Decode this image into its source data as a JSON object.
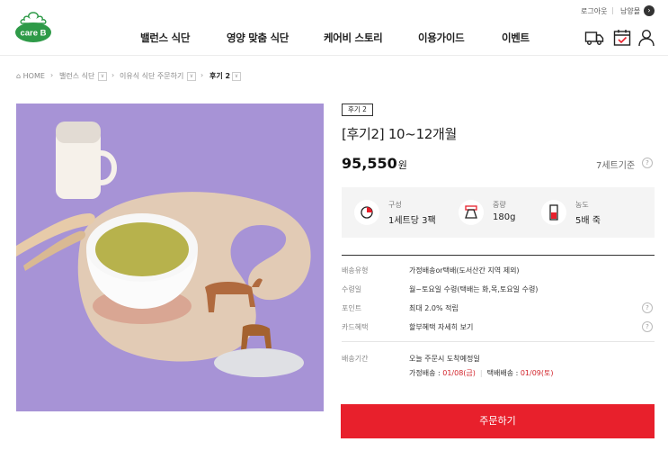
{
  "header": {
    "login_label": "로그아웃",
    "store_label": "남양몰",
    "logo_text": "care B",
    "nav": [
      "밸런스 식단",
      "영양 맞춤 식단",
      "케어비 스토리",
      "이용가이드",
      "이벤트"
    ],
    "icons": [
      "truck-icon",
      "calendar-check-icon",
      "user-icon"
    ]
  },
  "breadcrumb": {
    "home": "HOME",
    "items": [
      "밸런스 식단",
      "이유식 식단 주문하기",
      "후기 2"
    ]
  },
  "product": {
    "tag": "후기 2",
    "title": "[후기2] 10~12개월",
    "price": "95,550",
    "currency": "원",
    "set_basis": "7세트기준",
    "specs": [
      {
        "label": "구성",
        "value": "1세트당 3팩"
      },
      {
        "label": "중량",
        "value": "180g"
      },
      {
        "label": "농도",
        "value": "5배 죽"
      }
    ],
    "info_rows": [
      {
        "label": "배송유형",
        "value": "가정배송or택배(도서산간 지역 제외)"
      },
      {
        "label": "수령일",
        "value": "월~토요일 수령(택배는 화,목,토요일 수령)"
      },
      {
        "label": "포인트",
        "value": "최대 2.0% 적립"
      },
      {
        "label": "카드혜택",
        "value": "할부혜택 자세히 보기"
      }
    ],
    "delivery": {
      "label": "배송기간",
      "line1": "오늘 주문시 도착예정일",
      "home_label": "가정배송 : ",
      "home_date": "01/08(금)",
      "parcel_label": "택배배송 : ",
      "parcel_date": "01/09(토)"
    },
    "order_button": "주문하기"
  },
  "colors": {
    "accent": "#e8202c",
    "brand_green": "#2e9a48",
    "photo_bg": "#a793d6"
  }
}
